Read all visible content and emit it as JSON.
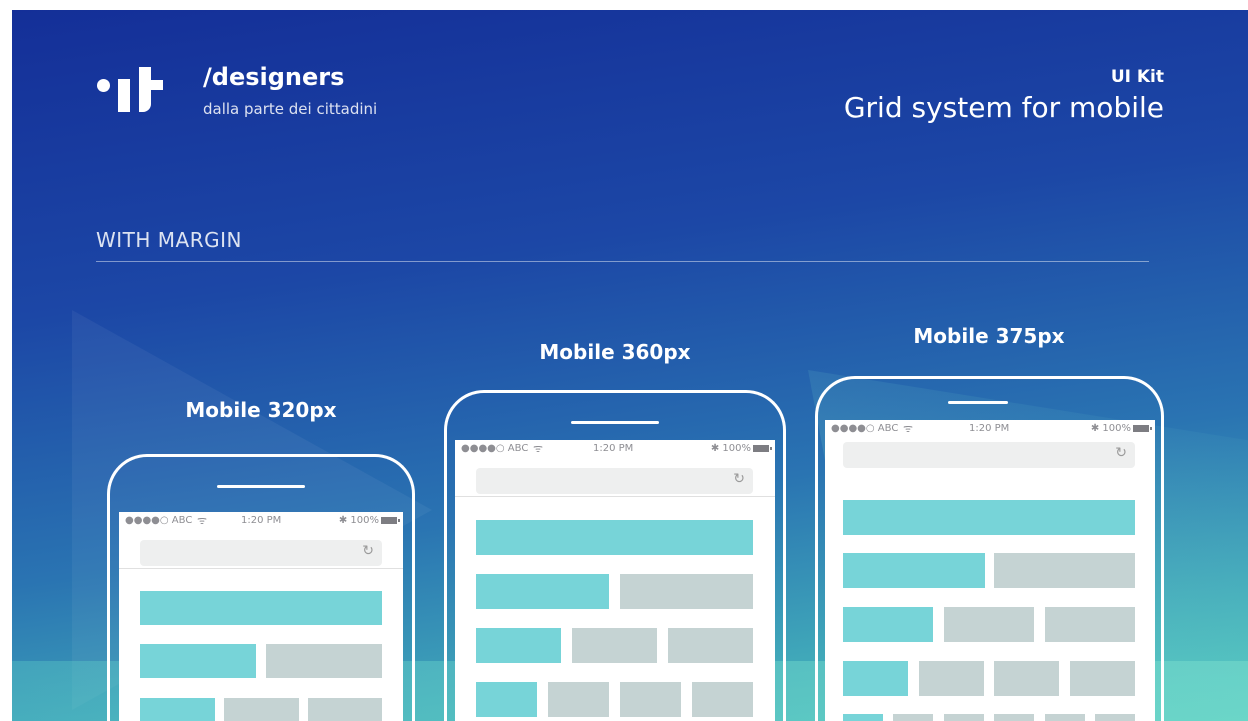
{
  "brand": {
    "logo_text": ".it",
    "name": "/designers",
    "tagline": "dalla parte dei cittadini"
  },
  "header": {
    "kit_label": "UI Kit",
    "title": "Grid system for mobile"
  },
  "section": {
    "title": "WITH MARGIN"
  },
  "status_bar": {
    "carrier": "●●●●○ ABC",
    "wifi_icon": "wifi-icon",
    "time": "1:20 PM",
    "bluetooth_icon": "bluetooth-icon",
    "battery": "100%"
  },
  "reload_icon": "↻",
  "devices": [
    {
      "label": "Mobile 320px"
    },
    {
      "label": "Mobile 360px"
    },
    {
      "label": "Mobile 375px"
    }
  ],
  "colors": {
    "column_accent": "#77d4d8",
    "column_neutral": "#c5d3d3",
    "background_top": "#142f98",
    "background_bottom": "#4fc7bd"
  }
}
